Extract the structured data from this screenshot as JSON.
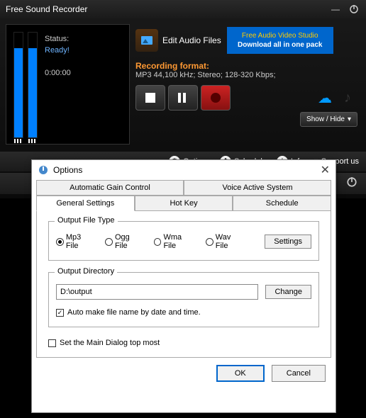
{
  "titlebar": {
    "title": "Free Sound Recorder"
  },
  "status": {
    "label": "Status:",
    "value": "Ready!",
    "time": "0:00:00"
  },
  "edit": {
    "label": "Edit Audio Files"
  },
  "promo": {
    "line1": "Free Audio Video Studio",
    "line2": "Download all in one pack"
  },
  "format": {
    "label": "Recording format:",
    "text": "MP3 44,100 kHz; Stereo;  128-320 Kbps;"
  },
  "showhide": {
    "label": "Show / Hide"
  },
  "bottombar": {
    "options": "Options",
    "schedule": "Schedule",
    "info": "Info",
    "support": "Support us"
  },
  "dialog": {
    "title": "Options",
    "tabs": {
      "agc": "Automatic Gain Control",
      "vas": "Voice Active System",
      "general": "General Settings",
      "hotkey": "Hot Key",
      "schedule": "Schedule"
    },
    "output": {
      "legend": "Output File Type",
      "mp3": "Mp3 File",
      "ogg": "Ogg File",
      "wma": "Wma File",
      "wav": "Wav File",
      "settings": "Settings"
    },
    "dir": {
      "legend": "Output Directory",
      "value": "D:\\output",
      "change": "Change",
      "autoname": "Auto make file name by date and time."
    },
    "topmost": "Set the Main Dialog top most",
    "ok": "OK",
    "cancel": "Cancel"
  }
}
